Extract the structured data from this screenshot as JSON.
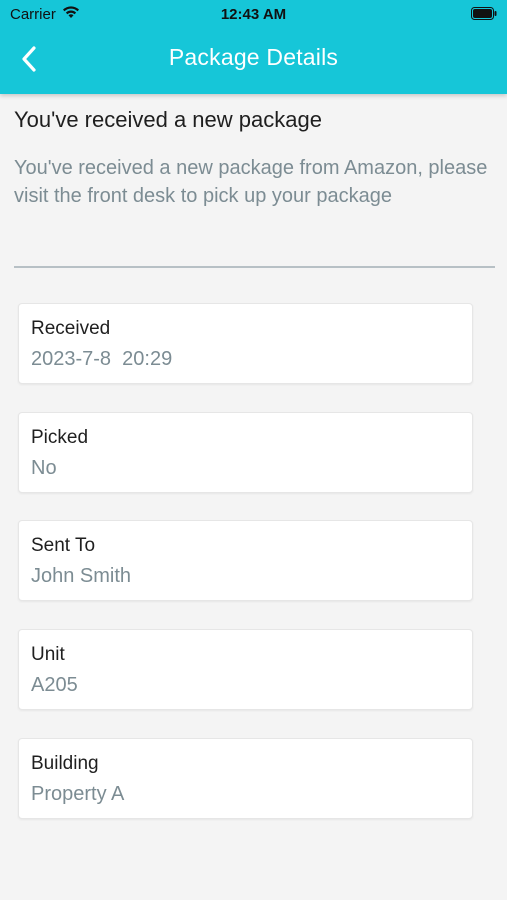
{
  "status_bar": {
    "carrier": "Carrier",
    "time": "12:43 AM"
  },
  "nav": {
    "title": "Package Details",
    "back_icon": "chevron-left-icon"
  },
  "notification": {
    "headline": "You've received a new package",
    "message": "You've received a new package from Amazon, please visit the front desk to pick up your package"
  },
  "details": [
    {
      "label": "Received",
      "value": "2023-7-8  20:29"
    },
    {
      "label": "Picked",
      "value": "No"
    },
    {
      "label": "Sent To",
      "value": "John Smith"
    },
    {
      "label": "Unit",
      "value": "A205"
    },
    {
      "label": "Building",
      "value": "Property A"
    }
  ],
  "colors": {
    "header": "#16c6d8",
    "secondary_text": "#7c8c93",
    "background": "#f4f4f4"
  }
}
